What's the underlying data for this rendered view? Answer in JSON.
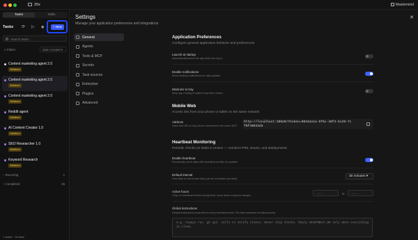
{
  "titlebar": {
    "app_name": "20x",
    "user_name": "Mastermind"
  },
  "sidebar": {
    "tabs": [
      "Tasks",
      "Skills"
    ],
    "heading": "Tasks",
    "new_label": "+ New",
    "search_placeholder": "Search tasks...",
    "filters_label": "Filters",
    "sort_value": "Date Created",
    "tasks": [
      {
        "name": "Content marketing agent 2.0",
        "badge": "Medium",
        "extra": "",
        "dot": "#e0e0e0"
      },
      {
        "name": "Content marketing agent 2.0",
        "badge": "Medium",
        "extra": "",
        "dot": "#a875ff"
      },
      {
        "name": "Content marketing agent 2.0",
        "badge": "Medium",
        "extra": "",
        "dot": "#a875ff"
      },
      {
        "name": "Reddit agent",
        "badge": "Medium",
        "extra": "",
        "dot": "#a875ff"
      },
      {
        "name": "AI Content Creator 1.0",
        "badge": "Medium",
        "extra": "",
        "dot": "#a875ff"
      },
      {
        "name": "SEO Researcher 1.0",
        "badge": "Medium",
        "extra": "",
        "dot": "#a875ff"
      },
      {
        "name": "Keyword Research",
        "badge": "Medium",
        "extra": "",
        "dot": "#a875ff"
      }
    ],
    "groups": [
      {
        "label": "Recurring",
        "count": "1"
      },
      {
        "label": "Completed",
        "count": "26"
      }
    ],
    "footer": "7 active · 34 total"
  },
  "settings": {
    "title": "Settings",
    "subtitle": "Manage your application preferences and integrations",
    "nav": [
      "General",
      "Agents",
      "Tools & MCP",
      "Secrets",
      "Task sources",
      "Enterprise",
      "Plugins",
      "Advanced"
    ],
    "app_prefs": {
      "title": "Application Preferences",
      "subtitle": "Configure general application behavior and preferences",
      "rows": [
        {
          "label": "Launch at startup",
          "desc": "Automatically launch the app when you log in",
          "on": false
        },
        {
          "label": "Enable notifications",
          "desc": "Show desktop notifications for task updates",
          "on": true
        },
        {
          "label": "Minimize to tray",
          "desc": "Keep app running in system tray when closed",
          "on": false
        }
      ]
    },
    "mobile": {
      "title": "Mobile Web",
      "subtitle": "Access 20x from your phone or tablet on the same network",
      "address_label": "Address",
      "address_desc": "Open this URL on any device connected to the same Wi-Fi",
      "url": "http://localhost:20620/#token=0634a11a-5f6c-48f2-bc29-7cf8f40633d3"
    },
    "heartbeat": {
      "title": "Heartbeat Monitoring",
      "subtitle": "Periodic checks on tasks in review — monitors PRs, issues, and deployments",
      "enable_label": "Enable heartbeat",
      "enable_desc": "Periodically check tasks with heartbeat.md files for updates",
      "enable_on": true,
      "interval_label": "Default interval",
      "interval_desc": "How often to check each task (can be overridden per-task)",
      "interval_value": "30 minutes",
      "active_label": "Active hours",
      "active_desc": "Only run heartbeat checks during these hours (leave empty for always)",
      "time_placeholder": "--:-- --",
      "to_label": "to",
      "global_label": "Global instructions",
      "global_desc": "Default instructions prepended to every heartbeat check. Per-task heartbeat.md takes priority.",
      "global_placeholder": "e.g. Always run `gh api` calls to verify status. Never skip checks. Reply HEARTBEAT_OK only when everything is clean."
    }
  },
  "colors": {
    "accent": "#3b5bff",
    "badge_bg": "#4a3b12",
    "badge_text": "#e8c552"
  }
}
